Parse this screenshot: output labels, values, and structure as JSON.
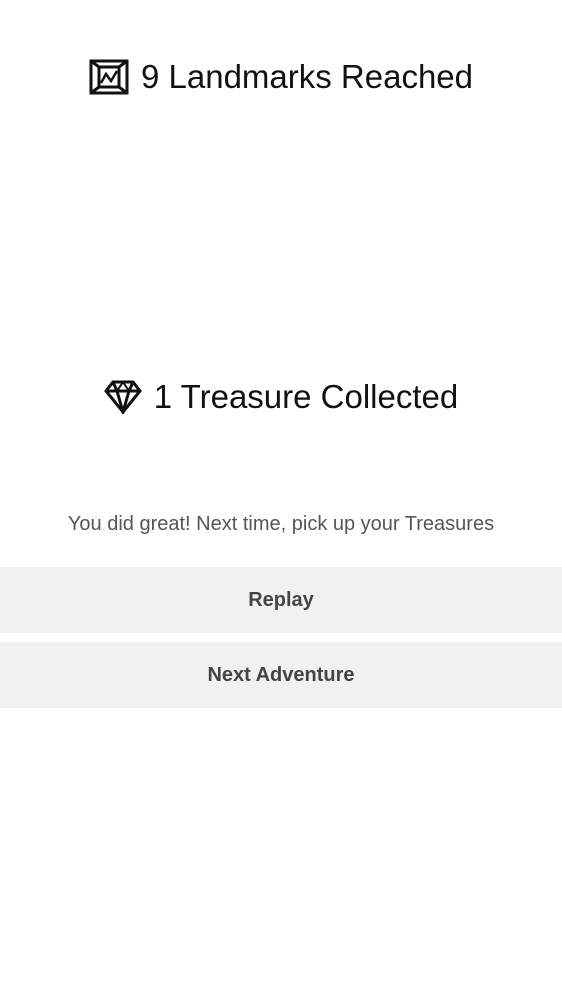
{
  "stats": {
    "landmarks": {
      "icon": "map-icon",
      "text": "9 Landmarks Reached"
    },
    "treasures": {
      "icon": "diamond-icon",
      "text": "1 Treasure Collected"
    }
  },
  "message": "You did great! Next time, pick up your Treasures",
  "buttons": {
    "replay_label": "Replay",
    "next_label": "Next Adventure"
  },
  "colors": {
    "background": "#ffffff",
    "button_background": "#f1f1f1",
    "button_text": "#444444",
    "message_text": "#555555",
    "heading_text": "#111111"
  }
}
